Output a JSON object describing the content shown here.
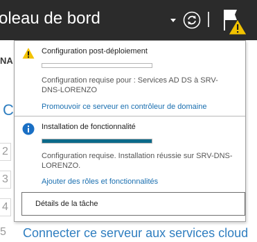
{
  "header": {
    "title": "oleau de bord"
  },
  "background": {
    "section_label": "NA",
    "c_char": "C",
    "steps": [
      "2",
      "3",
      "4"
    ],
    "step5_number": "5",
    "step5_link": "Connecter ce serveur aux services cloud"
  },
  "notifications": [
    {
      "icon": "warning-icon",
      "title": "Configuration post-déploiement",
      "progress": 0.0,
      "description": "Configuration requise pour : Services AD DS à SRV-DNS-LORENZO",
      "link": "Promouvoir ce serveur en contrôleur de domaine"
    },
    {
      "icon": "info-icon",
      "title": "Installation de fonctionnalité",
      "progress": 1.0,
      "description": "Configuration requise. Installation réussie sur SRV-DNS-LORENZO.",
      "link": "Ajouter des rôles et fonctionnalités"
    }
  ],
  "task_button": "Détails de la tâche",
  "colors": {
    "header_bg": "#2b2b2b",
    "link": "#1a6fb0",
    "progress_fill": "#0b6a8a",
    "warning": "#f2c200",
    "info": "#1a6fc4"
  }
}
